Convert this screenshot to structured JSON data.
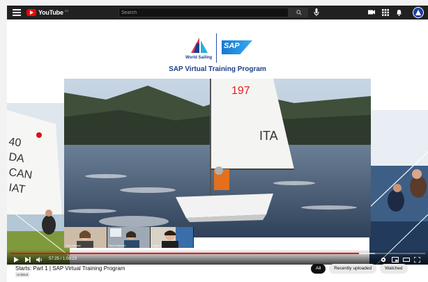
{
  "topbar": {
    "logo_text": "YouTube",
    "logo_country": "SG",
    "search_placeholder": "Search"
  },
  "brand": {
    "world_sailing": "World Sailing",
    "sap": "SAP",
    "program_title": "SAP Virtual Training Program"
  },
  "video": {
    "sail_number": "197",
    "sail_country": "ITA",
    "webcams": [
      {
        "label": "Paul Hodsal"
      },
      {
        "label": "Sina Hokoleri"
      },
      {
        "label": "Coach"
      }
    ]
  },
  "controls": {
    "time": "57:25 / 1:08:23",
    "progress": 0.84,
    "loaded": 0.88
  },
  "below": {
    "title": "Starts: Part 1 | SAP Virtual Training Program",
    "badge": "Unlisted"
  },
  "chips": [
    {
      "label": "All",
      "active": true
    },
    {
      "label": "Recently uploaded",
      "active": false
    },
    {
      "label": "Watched",
      "active": false
    }
  ],
  "colors": {
    "youtube_red": "#ff0000",
    "topbar": "#212121",
    "brand_blue": "#1e3e88"
  }
}
